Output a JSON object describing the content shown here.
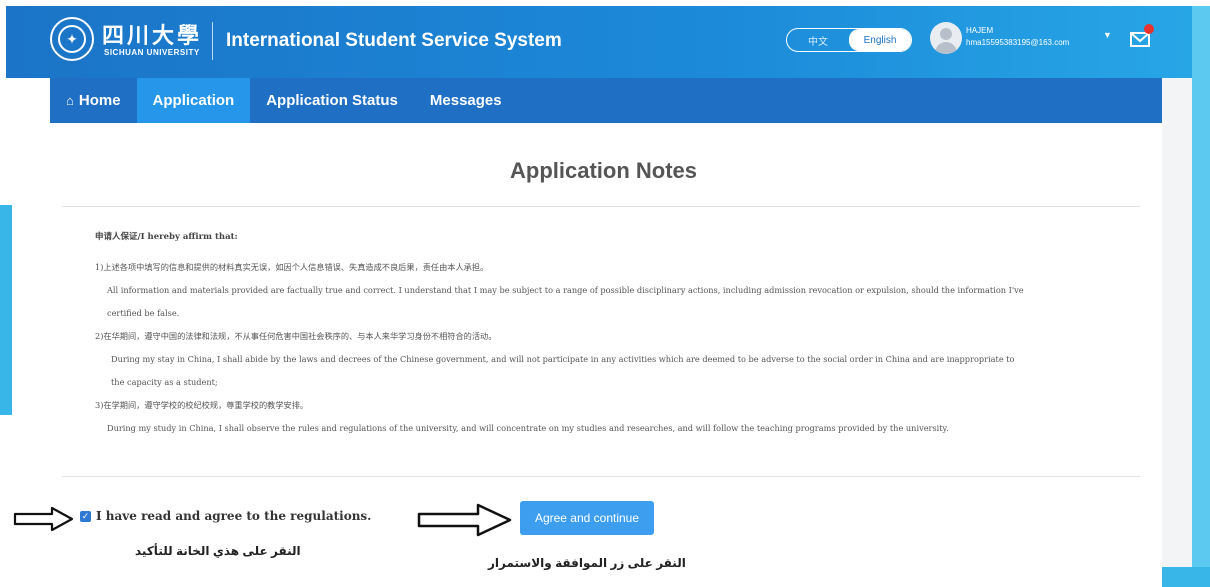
{
  "header": {
    "logo_cn": "四川大學",
    "logo_en": "SICHUAN UNIVERSITY",
    "title": "International Student Service System",
    "lang_zh": "中文",
    "lang_en": "English",
    "user_name": "HAJEM",
    "user_email": "hma15595383195@163.com"
  },
  "nav": {
    "home": "Home",
    "application": "Application",
    "status": "Application Status",
    "messages": "Messages"
  },
  "notes": {
    "title": "Application Notes",
    "heading": "申请人保证/I hereby affirm that:",
    "items": [
      {
        "cn": "1)上述各项中填写的信息和提供的材料真实无误，如因个人信息错误、失真造成不良后果，责任由本人承担。",
        "en": "All information and materials provided are factually true and correct. I understand that I may be subject to a range of possible disciplinary actions, including admission revocation or expulsion, should the information I've",
        "en_cont": "certified be false."
      },
      {
        "cn": "2)在华期间，遵守中国的法律和法规，不从事任何危害中国社会秩序的、与本人来华学习身份不相符合的活动。",
        "en": "During my stay in China, I shall abide by the laws and decrees of the Chinese government, and will not participate in any activities which are deemed to be adverse to the social order in China and are inappropriate to",
        "en_cont": "the capacity as a student;"
      },
      {
        "cn": "3)在学期间，遵守学校的校纪校规，尊重学校的教学安排。",
        "en": "During my study in China, I shall observe the rules and regulations of the university, and will concentrate on my studies and researches, and will follow the teaching programs provided by the university."
      }
    ]
  },
  "agreement": {
    "checked": true,
    "label": "I have read and agree to the regulations.",
    "button": "Agree and continue"
  },
  "annotations": {
    "checkbox_hint": "النقر على هذي الخانة للتأكيد",
    "button_hint": "النقر على زر الموافقة والاستمرار"
  },
  "icons": {
    "home": "home-icon",
    "mail": "mail-icon",
    "caret": "caret-down-icon",
    "check": "check-icon",
    "arrow": "right-arrow-icon"
  },
  "colors": {
    "header": "#1c8ad9",
    "nav": "#1f6fc5",
    "nav_active": "#2596ea",
    "button": "#3d9ef0",
    "badge": "#e8322e"
  }
}
